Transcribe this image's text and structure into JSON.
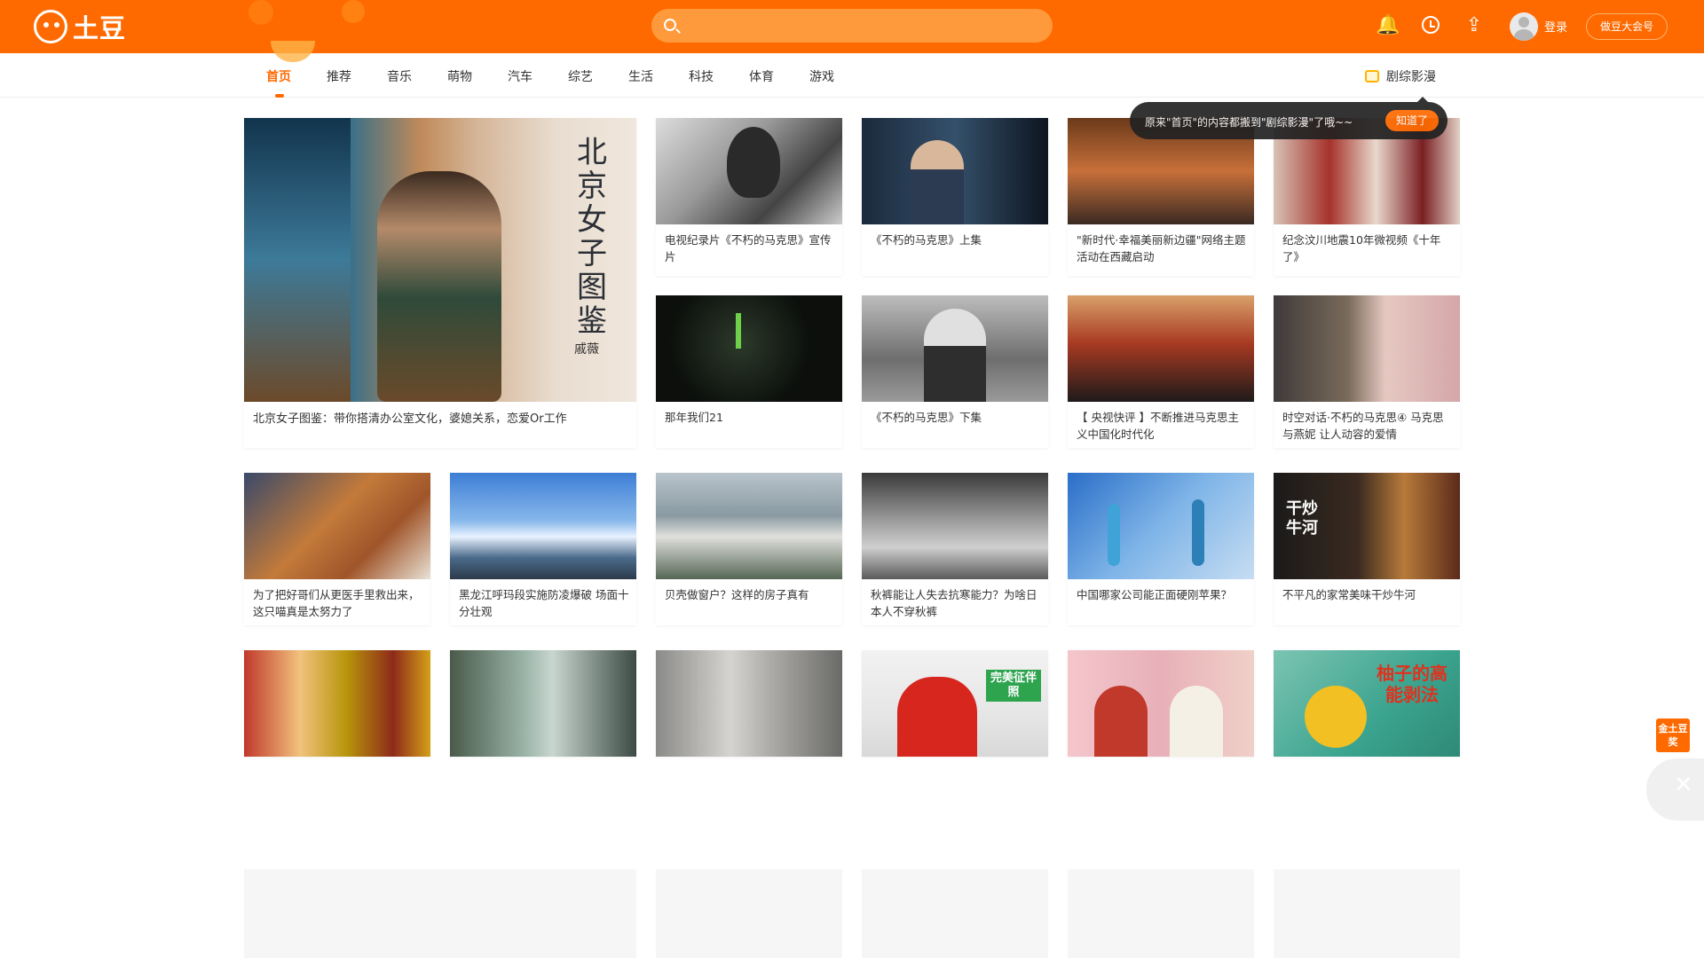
{
  "header": {
    "logo_text": "土豆",
    "search_placeholder": "",
    "login_label": "登录",
    "creator_label": "做豆大会号",
    "icons": [
      "bell-icon",
      "history-clock-icon",
      "upload-icon"
    ]
  },
  "nav": {
    "items": [
      "首页",
      "推荐",
      "音乐",
      "萌物",
      "汽车",
      "综艺",
      "生活",
      "科技",
      "体育",
      "游戏"
    ],
    "active": "首页",
    "right_link": "剧综影漫"
  },
  "tooltip": {
    "text": "原来\"首页\"的内容都搬到\"剧综影漫\"了哦~~",
    "button": "知道了"
  },
  "cards": [
    {
      "title": "北京女子图鉴：带你搭清办公室文化，婆媳关系，恋爱Or工作"
    },
    {
      "title": "电视纪录片《不朽的马克思》宣传片"
    },
    {
      "title": "《不朽的马克思》上集"
    },
    {
      "title": "\"新时代·幸福美丽新边疆\"网络主题活动在西藏启动"
    },
    {
      "title": "纪念汶川地震10年微视频《十年了》"
    },
    {
      "title": "那年我们21"
    },
    {
      "title": "《不朽的马克思》下集"
    },
    {
      "title": "【 央视快评 】不断推进马克思主义中国化时代化"
    },
    {
      "title": "时空对话·不朽的马克思④ 马克思与燕妮 让人动容的爱情"
    },
    {
      "title": "为了把好哥们从更医手里救出来，这只喵真是太努力了"
    },
    {
      "title": "黑龙江呼玛段实施防凌爆破 场面十分壮观"
    },
    {
      "title": "贝壳做窗户？这样的房子真有"
    },
    {
      "title": "秋裤能让人失去抗寒能力？为啥日本人不穿秋裤"
    },
    {
      "title": "中国哪家公司能正面硬刚苹果？"
    },
    {
      "title": "不平凡的家常美味干炒牛河"
    },
    {
      "title": ""
    },
    {
      "title": ""
    },
    {
      "title": ""
    },
    {
      "title": ""
    },
    {
      "title": ""
    },
    {
      "title": ""
    }
  ],
  "thumb_texts": {
    "poster_title": "北京女子图鉴",
    "poster_name": "戚薇",
    "selfie_badge": "完美征伴照",
    "pomelo_text": "柚子的高能剥法",
    "noodle_text": "干炒牛河"
  },
  "widget": {
    "gold_label": "金土豆奖",
    "close_symbol": "✕"
  }
}
